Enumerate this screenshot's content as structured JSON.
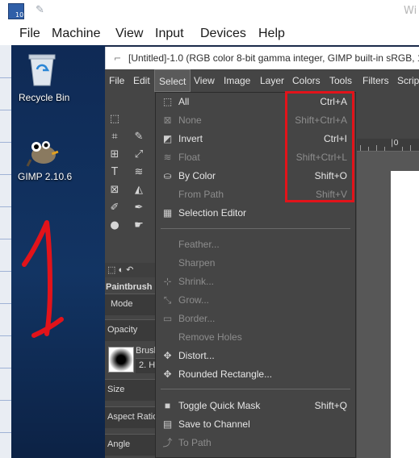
{
  "vbox": {
    "title": "Wi",
    "icon_badge": "10",
    "menu": [
      "File",
      "Machine",
      "View",
      "Input",
      "Devices",
      "Help"
    ]
  },
  "desktop": {
    "icons": [
      {
        "label": "Recycle Bin",
        "icon": "recycle-bin-icon"
      },
      {
        "label": "GIMP 2.10.6",
        "icon": "gimp-wilber-icon"
      }
    ],
    "annotation": "1",
    "annotation_color": "#e2131a"
  },
  "gimp": {
    "window_title": "[Untitled]-1.0 (RGB color 8-bit gamma integer, GIMP built-in sRGB, 1",
    "menubar": [
      "File",
      "Edit",
      "Select",
      "View",
      "Image",
      "Layer",
      "Colors",
      "Tools",
      "Filters",
      "Script"
    ],
    "active_menu": "Select",
    "tool_options": {
      "tool_name": "Paintbrush",
      "mode_label": "Mode",
      "opacity_label": "Opacity",
      "brush_label": "Brush",
      "brush_value": "2. H",
      "size_label": "Size",
      "aspect_label": "Aspect Ratio",
      "angle_label": "Angle"
    },
    "ruler_labels": [
      "|0"
    ]
  },
  "select_menu": {
    "items": [
      {
        "label": "All",
        "accel": "Ctrl+A",
        "icon": "select-all-icon",
        "enabled": true
      },
      {
        "label": "None",
        "accel": "Shift+Ctrl+A",
        "icon": "select-none-icon",
        "enabled": false
      },
      {
        "label": "Invert",
        "accel": "Ctrl+I",
        "icon": "invert-selection-icon",
        "enabled": true
      },
      {
        "label": "Float",
        "accel": "Shift+Ctrl+L",
        "icon": "float-selection-icon",
        "enabled": false
      },
      {
        "label": "By Color",
        "accel": "Shift+O",
        "icon": "by-color-select-icon",
        "enabled": true
      },
      {
        "label": "From Path",
        "accel": "Shift+V",
        "icon": "from-path-icon",
        "enabled": false
      },
      {
        "label": "Selection Editor",
        "accel": "",
        "icon": "selection-editor-icon",
        "enabled": true
      },
      {
        "label": "Feather...",
        "accel": "",
        "icon": "",
        "enabled": false
      },
      {
        "label": "Sharpen",
        "accel": "",
        "icon": "",
        "enabled": false
      },
      {
        "label": "Shrink...",
        "accel": "",
        "icon": "shrink-icon",
        "enabled": false
      },
      {
        "label": "Grow...",
        "accel": "",
        "icon": "grow-icon",
        "enabled": false
      },
      {
        "label": "Border...",
        "accel": "",
        "icon": "border-icon",
        "enabled": false
      },
      {
        "label": "Remove Holes",
        "accel": "",
        "icon": "",
        "enabled": false
      },
      {
        "label": "Distort...",
        "accel": "",
        "icon": "distort-icon",
        "enabled": true
      },
      {
        "label": "Rounded Rectangle...",
        "accel": "",
        "icon": "rounded-rectangle-icon",
        "enabled": true
      },
      {
        "label": "Toggle Quick Mask",
        "accel": "Shift+Q",
        "icon": "quick-mask-icon",
        "enabled": true
      },
      {
        "label": "Save to Channel",
        "accel": "",
        "icon": "save-channel-icon",
        "enabled": true
      },
      {
        "label": "To Path",
        "accel": "",
        "icon": "to-path-icon",
        "enabled": false
      }
    ],
    "highlight_color": "#e2131a"
  }
}
